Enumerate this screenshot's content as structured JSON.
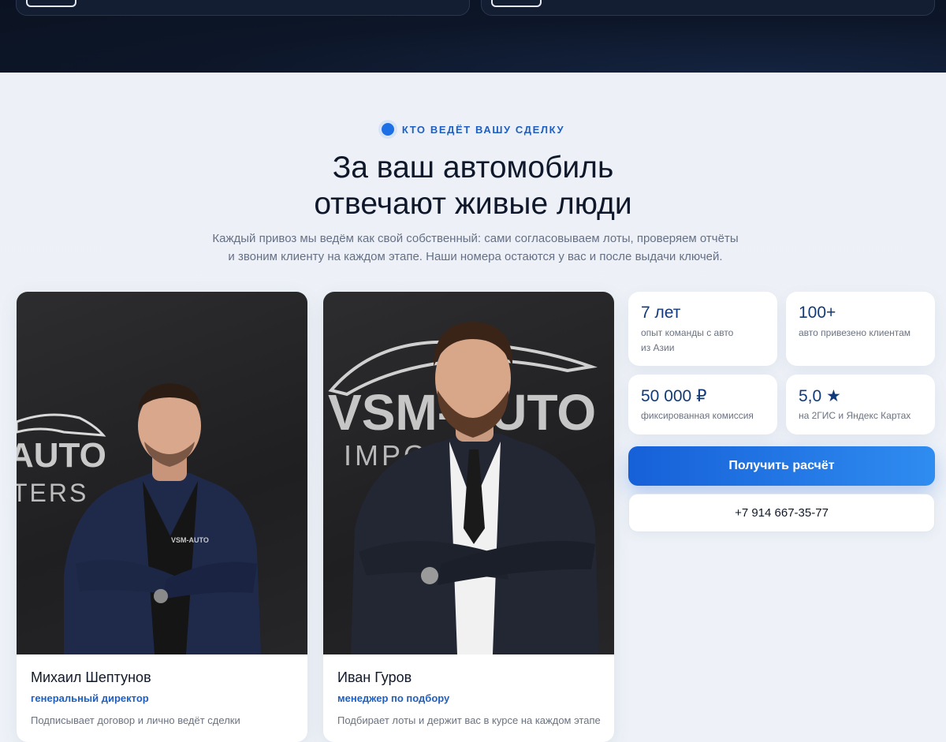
{
  "section": {
    "eyebrow": "КТО ВЕДЁТ ВАШУ СДЕЛКУ",
    "title_line1": "За ваш автомобиль",
    "title_line2": "отвечают живые люди",
    "subtitle_line1": "Каждый привоз мы ведём как свой собственный: сами согласовываем лоты, проверяем отчёты",
    "subtitle_line2": "и звоним клиенту на каждом этапе. Наши номера остаются у вас и после выдачи ключей."
  },
  "team": [
    {
      "name": "Михаил Шептунов",
      "role": "генеральный директор",
      "desc": "Подписывает договор и лично ведёт сделки",
      "wall_logo_line1": "AUTO",
      "wall_logo_line2": "TERS",
      "jacket_logo": "VSM-AUTO"
    },
    {
      "name": "Иван Гуров",
      "role": "менеджер по подбору",
      "desc": "Подбирает лоты и держит вас в курсе на каждом этапе",
      "wall_logo_line1": "VSM-AUTO",
      "wall_logo_line2": "IMPORTERS"
    }
  ],
  "stats": [
    {
      "value": "7 лет",
      "caption": "опыт команды с авто из Азии"
    },
    {
      "value": "100+",
      "caption": "авто привезено клиентам"
    },
    {
      "value": "50 000 ₽",
      "caption": "фиксированная комиссия"
    },
    {
      "value": "5,0 ★",
      "caption": "на 2ГИС и Яндекс Картах"
    }
  ],
  "cta_label": "Получить расчёт",
  "phone": "+7 914 667-35-77",
  "colors": {
    "accent": "#1d6fe6",
    "dark_band": "#0d1628",
    "stat_value": "#123a7a"
  }
}
